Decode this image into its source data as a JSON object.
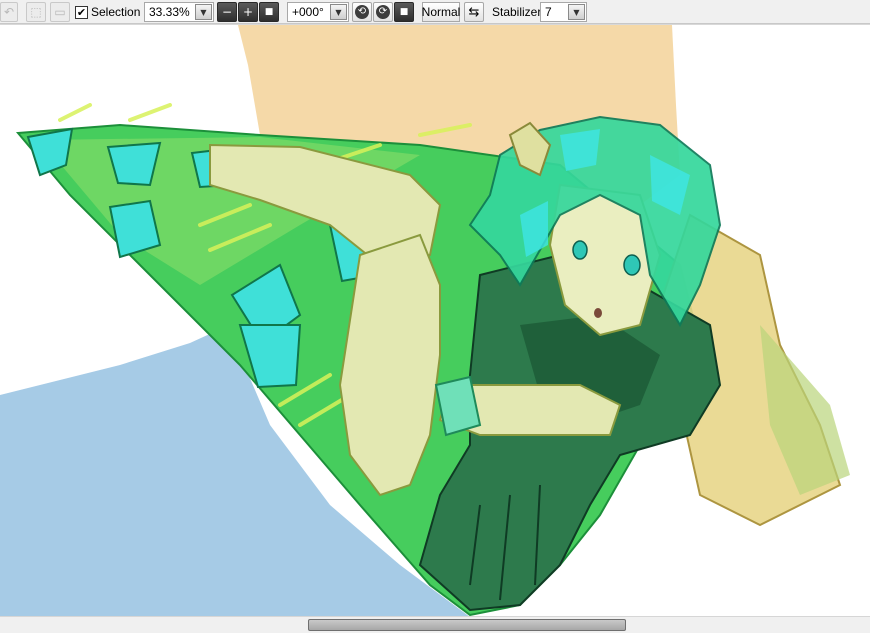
{
  "toolbar": {
    "undo_icon": "undo-icon",
    "deselect_icon": "deselect-icon",
    "select_all_icon": "select-all-icon",
    "selection": {
      "label": "Selection",
      "checked": true,
      "check_glyph": "✔"
    },
    "zoom": {
      "value": "33.33%",
      "dropdown_glyph": "▼"
    },
    "zoom_out_glyph": "−",
    "zoom_in_glyph": "+",
    "zoom_reset_glyph": "■",
    "rotation": {
      "value": "+000°",
      "dropdown_glyph": "▼"
    },
    "rotate_ccw_glyph": "⟲",
    "rotate_cw_glyph": "⟳",
    "rotate_reset_glyph": "■",
    "blend_mode": "Normal",
    "flip_glyph": "⇆",
    "stabilizer": {
      "label": "Stabilizer",
      "value": "7",
      "dropdown_glyph": "▼"
    }
  },
  "colors": {
    "toolbar_bg": "#f0f0f0",
    "canvas_bg": "#ffffff",
    "background_tan": "#f5d9a8",
    "background_blue": "#a6cbe6",
    "crystal_green": "#3fce5f",
    "crystal_cyan": "#3de0e0",
    "hair_green": "#2fd39a",
    "skin": "#e6e8b8",
    "uniform_dark": "#1e6a45"
  }
}
